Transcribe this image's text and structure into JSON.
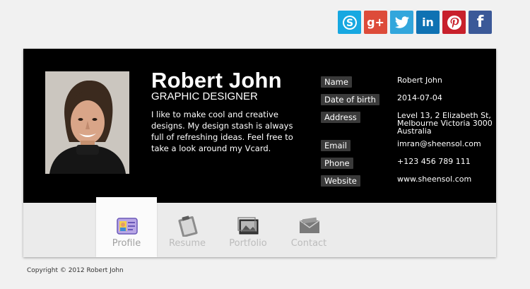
{
  "social": {
    "icons": [
      "skype-icon",
      "google-plus-icon",
      "twitter-icon",
      "linkedin-icon",
      "pinterest-icon",
      "facebook-icon"
    ],
    "gplus_text": "g+",
    "linkedin_text": "in",
    "facebook_text": "f"
  },
  "profile": {
    "name": "Robert John",
    "title": "GRAPHIC DESIGNER",
    "bio": "I like to make cool and creative designs. My design stash is always full of refreshing ideas. Feel free to take a look around my Vcard."
  },
  "details": {
    "name_label": "Name",
    "name_value": "Robert John",
    "dob_label": "Date of birth",
    "dob_value": "2014-07-04",
    "address_label": "Address",
    "address_value": "Level 13, 2 Elizabeth St, Melbourne Victoria 3000 Australia",
    "email_label": "Email",
    "email_value": "imran@sheensol.com",
    "phone_label": "Phone",
    "phone_value": "+123 456 789 111",
    "website_label": "Website",
    "website_value": "www.sheensol.com"
  },
  "tabs": [
    {
      "label": "Profile",
      "active": true
    },
    {
      "label": "Resume",
      "active": false
    },
    {
      "label": "Portfolio",
      "active": false
    },
    {
      "label": "Contact",
      "active": false
    }
  ],
  "footer": {
    "copyright": "Copyright © 2012 Robert John"
  },
  "colors": {
    "card_top": "#000000",
    "label_bg": "#3a3a3a",
    "skype": "#17a8e1",
    "gplus": "#dd4b39",
    "twitter": "#32a6dc",
    "linkedin": "#0f72b3",
    "pinterest": "#c8202b",
    "facebook": "#3b5998"
  }
}
